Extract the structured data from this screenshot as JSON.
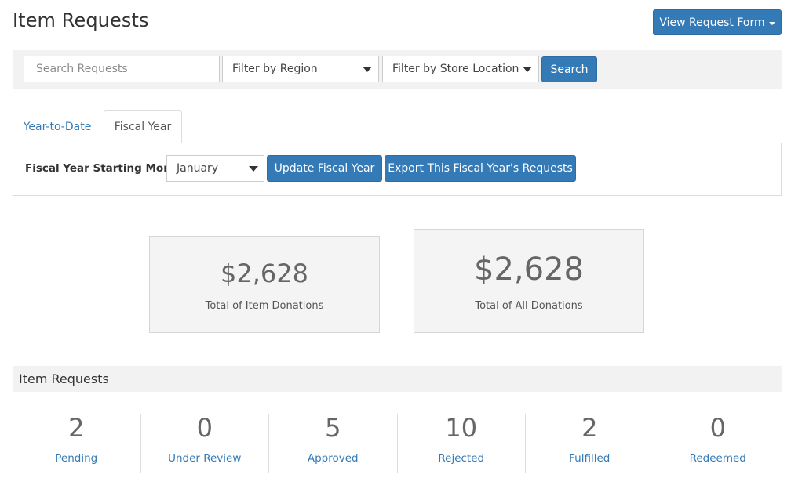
{
  "page": {
    "title": "Item Requests",
    "view_form_label": "View Request Form"
  },
  "search": {
    "placeholder": "Search Requests",
    "value": "",
    "region_selected": "Filter by Region",
    "store_selected": "Filter by Store Location",
    "search_label": "Search"
  },
  "tabs": [
    {
      "label": "Year-to-Date",
      "active": false
    },
    {
      "label": "Fiscal Year",
      "active": true
    }
  ],
  "fiscal": {
    "label": "Fiscal Year Starting Month:",
    "month_selected": "January",
    "update_label": "Update Fiscal Year",
    "export_label": "Export This Fiscal Year's Requests"
  },
  "stats": {
    "item_donations": {
      "amount": "$2,628",
      "caption": "Total of Item Donations"
    },
    "all_donations": {
      "amount": "$2,628",
      "caption": "Total of All Donations"
    }
  },
  "requests": {
    "header": "Item Requests",
    "counts": [
      {
        "value": "2",
        "label": "Pending"
      },
      {
        "value": "0",
        "label": "Under Review"
      },
      {
        "value": "5",
        "label": "Approved"
      },
      {
        "value": "10",
        "label": "Rejected"
      },
      {
        "value": "2",
        "label": "Fulfilled"
      },
      {
        "value": "0",
        "label": "Redeemed"
      }
    ]
  },
  "colors": {
    "primary": "#337ab7",
    "panel_bg": "#f2f2f2",
    "stat_bg": "#f4f4f4",
    "border": "#dddddd"
  }
}
